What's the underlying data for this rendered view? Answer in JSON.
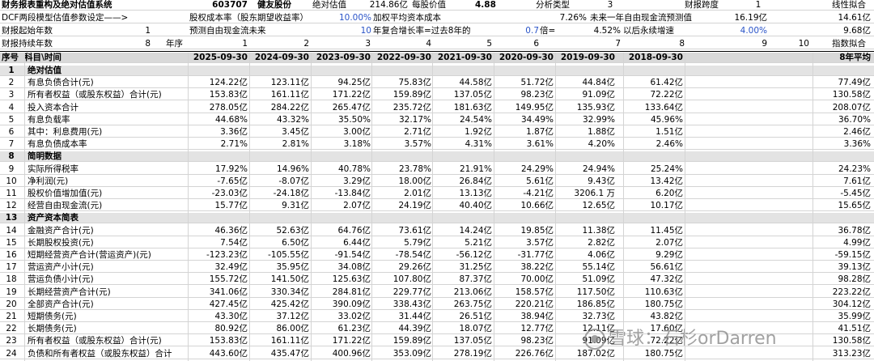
{
  "meta": {
    "title": "财务报表重构及绝对估值系统",
    "code": "603707",
    "name": "健友股份",
    "abs_val_label": "绝对估值",
    "abs_val": "214.86亿",
    "per_share_label": "每股价值",
    "per_share": "4.88",
    "analysis_type_label": "分析类型",
    "analysis_type": "3",
    "span_label": "财报跨度",
    "span": "1",
    "fit_label": "线性拟合"
  },
  "params": {
    "dcf_label": "DCF两段模型估值参数设定——>",
    "cost_equity_label": "股权成本率（股东期望收益率）",
    "cost_equity": "10.00%",
    "wacc_label": "加权平均资本成本",
    "wacc": "7.26%",
    "fcf_next_label": "未来一年自由现金流预测值",
    "fcf_next": "16.19亿",
    "right1": "14.61亿",
    "start_label": "财报起始年数",
    "start": "1",
    "forecast_label": "预测自由现金流未来",
    "forecast": "10",
    "cagr_label": "年复合增长率=过去8年的",
    "cagr": "0.7",
    "times_label": "倍=",
    "times": "4.52%",
    "perp_label": "以后永续增速",
    "perp": "4.00%",
    "right2": "9.68亿",
    "duration_label": "财报持续年数",
    "duration": "8",
    "seq_label": "年序",
    "seq": [
      "1",
      "2",
      "3",
      "4",
      "5",
      "6",
      "7",
      "8",
      "9",
      "10"
    ],
    "exp_fit_label": "指数拟合"
  },
  "table": {
    "col_no": "序号",
    "col_item": "科目\\时间",
    "dates": [
      "2025-09-30",
      "2024-09-30",
      "2023-09-30",
      "2022-09-30",
      "2021-09-30",
      "2020-09-30",
      "2019-09-30",
      "2018-09-30"
    ],
    "avg_label": "8年平均",
    "rows": [
      {
        "no": "1",
        "item": "绝对估值",
        "section": true
      },
      {
        "no": "2",
        "item": "有息负债合计(元)",
        "vals": [
          "124.22亿",
          "123.11亿",
          "94.25亿",
          "75.83亿",
          "44.58亿",
          "51.72亿",
          "44.84亿",
          "61.42亿"
        ],
        "avg": "77.49亿"
      },
      {
        "no": "3",
        "item": "所有者权益（或股东权益）合计(元)",
        "vals": [
          "153.83亿",
          "161.11亿",
          "171.22亿",
          "159.89亿",
          "137.05亿",
          "98.23亿",
          "91.09亿",
          "72.22亿"
        ],
        "avg": "130.58亿"
      },
      {
        "no": "4",
        "item": "投入资本合计",
        "vals": [
          "278.05亿",
          "284.22亿",
          "265.47亿",
          "235.72亿",
          "181.63亿",
          "149.95亿",
          "135.93亿",
          "133.64亿"
        ],
        "avg": "208.07亿"
      },
      {
        "no": "5",
        "item": "有息负载率",
        "vals": [
          "44.68%",
          "43.32%",
          "35.50%",
          "32.17%",
          "24.54%",
          "34.49%",
          "32.99%",
          "45.96%"
        ],
        "avg": "36.70%"
      },
      {
        "no": "6",
        "item": "其中：利息费用(元)",
        "vals": [
          "3.36亿",
          "3.45亿",
          "3.00亿",
          "2.71亿",
          "1.92亿",
          "1.87亿",
          "1.88亿",
          "1.51亿"
        ],
        "avg": "2.46亿"
      },
      {
        "no": "7",
        "item": "有息负债成本率",
        "vals": [
          "2.71%",
          "2.81%",
          "3.18%",
          "3.57%",
          "4.31%",
          "3.61%",
          "4.20%",
          "2.46%"
        ],
        "avg": "3.36%"
      },
      {
        "no": "8",
        "item": "简明数据",
        "section": true
      },
      {
        "no": "9",
        "item": "实际所得税率",
        "vals": [
          "17.92%",
          "14.96%",
          "40.78%",
          "23.78%",
          "21.91%",
          "24.29%",
          "24.94%",
          "25.24%"
        ],
        "avg": "24.23%"
      },
      {
        "no": "10",
        "item": "净利润(元)",
        "vals": [
          "-7.65亿",
          "-8.07亿",
          "3.29亿",
          "18.00亿",
          "26.84亿",
          "5.61亿",
          "9.43亿",
          "13.42亿"
        ],
        "avg": "7.61亿"
      },
      {
        "no": "11",
        "item": "股权价值增加值(元)",
        "vals": [
          "-23.03亿",
          "-24.18亿",
          "-13.84亿",
          "2.01亿",
          "13.13亿",
          "-4.21亿",
          "3206.1 万",
          "6.20亿"
        ],
        "avg": "-5.45亿"
      },
      {
        "no": "12",
        "item": "经营自由现金流(元)",
        "vals": [
          "15.77亿",
          "9.31亿",
          "2.07亿",
          "24.19亿",
          "40.40亿",
          "10.66亿",
          "12.65亿",
          "10.17亿"
        ],
        "avg": "15.65亿"
      },
      {
        "no": "13",
        "item": "资产资本简表",
        "section": true
      },
      {
        "no": "14",
        "item": "金融资产合计(元)",
        "vals": [
          "46.36亿",
          "52.63亿",
          "64.76亿",
          "73.61亿",
          "14.24亿",
          "19.85亿",
          "11.38亿",
          "11.45亿"
        ],
        "avg": "36.78亿"
      },
      {
        "no": "15",
        "item": "长期股权投资(元)",
        "vals": [
          "7.54亿",
          "6.50亿",
          "6.44亿",
          "5.79亿",
          "5.21亿",
          "3.57亿",
          "2.82亿",
          "2.07亿"
        ],
        "avg": "4.99亿"
      },
      {
        "no": "16",
        "item": "短期经营资产合计(营运资产)(元)",
        "vals": [
          "-123.23亿",
          "-105.55亿",
          "-91.54亿",
          "-78.54亿",
          "-56.12亿",
          "-31.77亿",
          "4.06亿",
          "9.29亿"
        ],
        "avg": "-59.15亿"
      },
      {
        "no": "17",
        "item": "营运资产小计(元)",
        "vals": [
          "32.49亿",
          "35.95亿",
          "34.08亿",
          "29.26亿",
          "31.25亿",
          "38.22亿",
          "55.14亿",
          "56.61亿"
        ],
        "avg": "39.13亿"
      },
      {
        "no": "18",
        "item": "营运负债小计(元)",
        "vals": [
          "155.72亿",
          "141.50亿",
          "125.63亿",
          "107.80亿",
          "87.37亿",
          "70.00亿",
          "51.09亿",
          "47.32亿"
        ],
        "avg": "98.28亿"
      },
      {
        "no": "19",
        "item": "长期经营资产合计(元)",
        "vals": [
          "341.06亿",
          "330.34亿",
          "284.81亿",
          "229.77亿",
          "213.06亿",
          "158.57亿",
          "117.50亿",
          "110.63亿"
        ],
        "avg": "223.22亿"
      },
      {
        "no": "20",
        "item": "全部资产合计(元)",
        "vals": [
          "427.45亿",
          "425.42亿",
          "390.09亿",
          "338.43亿",
          "263.75亿",
          "220.21亿",
          "186.85亿",
          "180.75亿"
        ],
        "avg": "304.12亿"
      },
      {
        "no": "21",
        "item": "短期债务(元)",
        "vals": [
          "43.30亿",
          "37.12亿",
          "33.02亿",
          "31.44亿",
          "26.51亿",
          "38.94亿",
          "32.73亿",
          "43.82亿"
        ],
        "avg": "35.99亿"
      },
      {
        "no": "22",
        "item": "长期债务(元)",
        "vals": [
          "80.92亿",
          "86.00亿",
          "61.23亿",
          "44.39亿",
          "18.07亿",
          "12.77亿",
          "12.11亿",
          "17.60亿"
        ],
        "avg": "41.51亿"
      },
      {
        "no": "23",
        "item": "所有者权益（或股东权益）合计(元)",
        "vals": [
          "153.83亿",
          "161.11亿",
          "171.22亿",
          "159.89亿",
          "137.05亿",
          "98.23亿",
          "91.09亿",
          "72.22亿"
        ],
        "avg": "130.58亿"
      },
      {
        "no": "24",
        "item": "负债和所有者权益（或股东权益）合计",
        "vals": [
          "443.60亿",
          "435.47亿",
          "400.96亿",
          "353.09亿",
          "278.19亿",
          "226.76亿",
          "187.02亿",
          "180.75亿"
        ],
        "avg": "313.23亿"
      }
    ]
  },
  "watermark": "雪球：石杉orDarren"
}
